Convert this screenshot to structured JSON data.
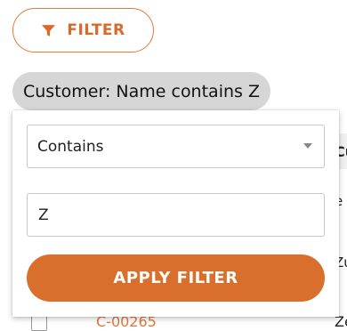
{
  "toolbar": {
    "filter_label": "FILTER",
    "icon": "filter-icon"
  },
  "active_filter_chip": {
    "label": "Customer: Name contains Z"
  },
  "background_table": {
    "column_header_partial": "Cu",
    "right_cells": [
      "e",
      "Zu"
    ],
    "last_row": {
      "link_partial": "C-00265",
      "right_cell": "Ze"
    }
  },
  "filter_popup": {
    "operator_select": {
      "value": "Contains",
      "icon": "chevron-down-icon"
    },
    "value_input": {
      "value": "Z"
    },
    "apply_label": "APPLY FILTER"
  },
  "colors": {
    "accent": "#d96f2c",
    "chip_bg": "#d6d6d6"
  }
}
